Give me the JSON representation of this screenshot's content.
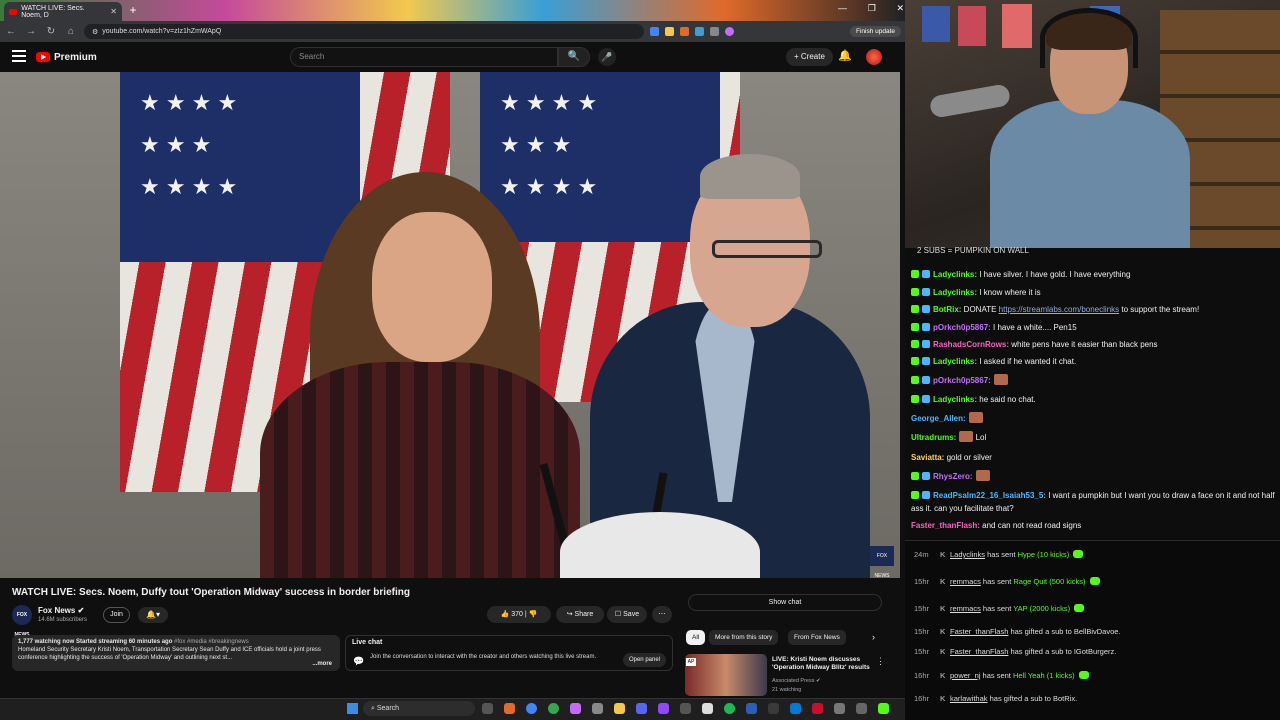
{
  "browser": {
    "tab_title": "WATCH LIVE: Secs. Noem, D",
    "tab_close": "✕",
    "new_tab": "+",
    "url": "youtube.com/watch?v=zIz1hZmWApQ",
    "finish_update": "Finish update",
    "window_controls": [
      "—",
      "❐",
      "✕"
    ]
  },
  "youtube": {
    "logo_text": "Premium",
    "search_placeholder": "Search",
    "create_label": "+ Create"
  },
  "video": {
    "title": "WATCH LIVE: Secs. Noem, Duffy tout 'Operation Midway' success in border briefing",
    "watermark": "FOX NEWS",
    "channel": {
      "name": "Fox News ✔",
      "subscribers": "14.6M subscribers",
      "logo_text": "FOX NEWS",
      "join_label": "Join"
    },
    "actions": {
      "likes": "👍 370  |  👎",
      "share": "↪ Share",
      "save": "☐ Save",
      "more": "⋯"
    },
    "description": {
      "stats": "1,777 watching now  Started streaming 60 minutes ago",
      "tags": "#fox #media #breakingnews",
      "text": "Homeland Security Secretary Kristi Noem, Transportation Secretary Sean Duffy and ICE officials hold a joint press conference highlighting the success of 'Operation Midway' and outlining next st...",
      "more": "...more"
    },
    "live_chat": {
      "title": "Live chat",
      "text": "Join the conversation to interact with the creator and others watching this live stream.",
      "open_panel": "Open panel"
    }
  },
  "sidebar": {
    "show_chat": "Show chat",
    "chips": [
      "All",
      "More from this story",
      "From Fox News"
    ],
    "next_chip": "›",
    "recommendation": {
      "badge": "AP",
      "title": "LIVE: Kristi Noem discusses 'Operation Midway Blitz' results",
      "channel": "Associated Press ✔",
      "watching": "21 watching"
    }
  },
  "taskbar": {
    "search": "Search"
  },
  "stream_chat": {
    "banner": "2 SUBS = PUMPKIN ON WALL",
    "messages": [
      {
        "name": "Ladyclinks:",
        "color": "#53fc18",
        "text": " I have silver. I have gold. I have everything"
      },
      {
        "name": "Ladyclinks:",
        "color": "#53fc18",
        "text": " I know where it is"
      },
      {
        "name": "BotRix:",
        "color": "#53fc18",
        "text": " DONATE ",
        "link": "https://streamlabs.com/boneclinks",
        "after": " to support the stream!"
      },
      {
        "name": "pOrkch0p5867:",
        "color": "#c46bff",
        "text": " I have a white.... Pen15"
      },
      {
        "name": "RashadsCornRows:",
        "color": "#ff5ec4",
        "text": " white pens have it easier than black pens"
      },
      {
        "name": "Ladyclinks:",
        "color": "#53fc18",
        "text": " I asked if he wanted it chat."
      },
      {
        "name": "pOrkch0p5867:",
        "color": "#c46bff",
        "text": ""
      },
      {
        "name": "Ladyclinks:",
        "color": "#53fc18",
        "text": " he said no chat."
      },
      {
        "name": "George_Allen:",
        "color": "#4ab8ff",
        "text": ""
      },
      {
        "name": "Ultradrums:",
        "color": "#53fc18",
        "text": " Lol"
      },
      {
        "name": "Saviatta:",
        "color": "#ffd166",
        "text": " gold or silver"
      },
      {
        "name": "RhysZero:",
        "color": "#c46bff",
        "text": ""
      },
      {
        "name": "ReadPsalm22_16_Isaiah53_5:",
        "color": "#4ab8ff",
        "text": " I want a pumpkin but I want you to draw a face on it and not half ass it. can you facilitate that?"
      },
      {
        "name": "Faster_thanFlash:",
        "color": "#ff5ec4",
        "text": " and can not read road signs"
      }
    ],
    "events": [
      {
        "time": "24m",
        "user": "Ladyclinks",
        "action": " has sent ",
        "item": "Hype (10 kicks)",
        "coin": true
      },
      {
        "time": "15hr",
        "user": "remmacs",
        "action": " has sent ",
        "item": "Rage Quit (500 kicks)",
        "coin": true
      },
      {
        "time": "15hr",
        "user": "remmacs",
        "action": " has sent ",
        "item": "YAP (2000 kicks)",
        "coin": true
      },
      {
        "time": "15hr",
        "user": "Faster_thanFlash",
        "action": " has gifted a sub to ",
        "item": "BellBivDavoe.",
        "coin": false
      },
      {
        "time": "15hr",
        "user": "Faster_thanFlash",
        "action": " has gifted a sub to ",
        "item": "IGotBurgerz.",
        "coin": false
      },
      {
        "time": "16hr",
        "user": "power_nj",
        "action": " has sent ",
        "item": "Hell Yeah (1 kicks)",
        "coin": true
      },
      {
        "time": "16hr",
        "user": "karlawithak",
        "action": " has gifted a sub to ",
        "item": "BotRix.",
        "coin": false
      }
    ]
  },
  "colors": {
    "youtube_red": "#ff0000",
    "kick_green": "#53fc18",
    "background": "#0f0f0f"
  }
}
